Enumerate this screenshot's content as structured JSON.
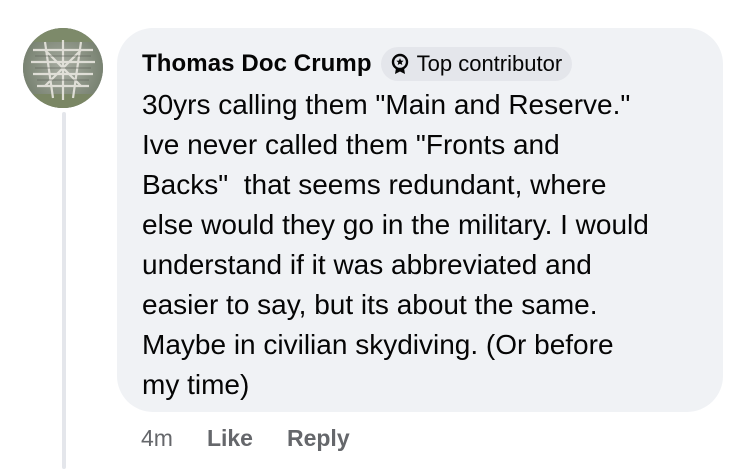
{
  "comment": {
    "author": "Thomas Doc Crump",
    "badge": {
      "label": "Top contributor",
      "icon": "award-badge-icon"
    },
    "text_lines": [
      "30yrs calling them \"Main and Reserve.\"",
      "Ive never called them \"Fronts and",
      "Backs\"  that seems redundant, where",
      "else would they go in the military. I would",
      "understand if it was abbreviated and",
      "easier to say, but its about the same.",
      "Maybe in civilian skydiving. (Or before",
      "my time)"
    ],
    "timestamp": "4m",
    "like_label": "Like",
    "reply_label": "Reply"
  },
  "colors": {
    "bubble_background": "#f0f2f5",
    "badge_background": "#e4e6eb",
    "primary_text": "#050505",
    "secondary_text": "#65676b",
    "thread_line": "#e4e6eb"
  }
}
